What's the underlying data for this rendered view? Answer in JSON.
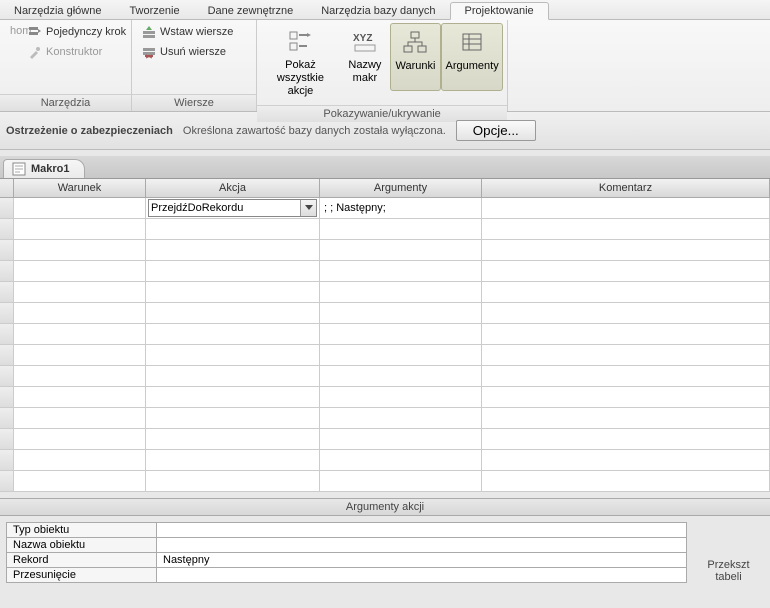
{
  "tabs": {
    "home": "Narzędzia główne",
    "create": "Tworzenie",
    "external": "Dane zewnętrzne",
    "dbtools": "Narzędzia bazy danych",
    "design": "Projektowanie"
  },
  "ribbon": {
    "tools": {
      "single_step": "Pojedynczy krok",
      "builder": "Konstruktor",
      "run_suffix": "hom",
      "label": "Narzędzia"
    },
    "rows": {
      "insert": "Wstaw wiersze",
      "delete": "Usuń wiersze",
      "label": "Wiersze"
    },
    "showhide": {
      "show_all1": "Pokaż",
      "show_all2": "wszystkie akcje",
      "names1": "Nazwy",
      "names2": "makr",
      "conditions": "Warunki",
      "arguments": "Argumenty",
      "label": "Pokazywanie/ukrywanie"
    }
  },
  "security": {
    "title": "Ostrzeżenie o zabezpieczeniach",
    "msg": "Określona zawartość bazy danych została wyłączona.",
    "btn": "Opcje..."
  },
  "doc_tab": "Makro1",
  "grid": {
    "h_war": "Warunek",
    "h_akc": "Akcja",
    "h_arg": "Argumenty",
    "h_kom": "Komentarz",
    "row1_action": "PrzejdźDoRekordu",
    "row1_args": "; ; Następny;"
  },
  "args_panel": {
    "title": "Argumenty akcji",
    "r1": "Typ obiektu",
    "r2": "Nazwa obiektu",
    "r3": "Rekord",
    "r3v": "Następny",
    "r4": "Przesunięcie",
    "side1": "Przekszt",
    "side2": "tabeli"
  }
}
